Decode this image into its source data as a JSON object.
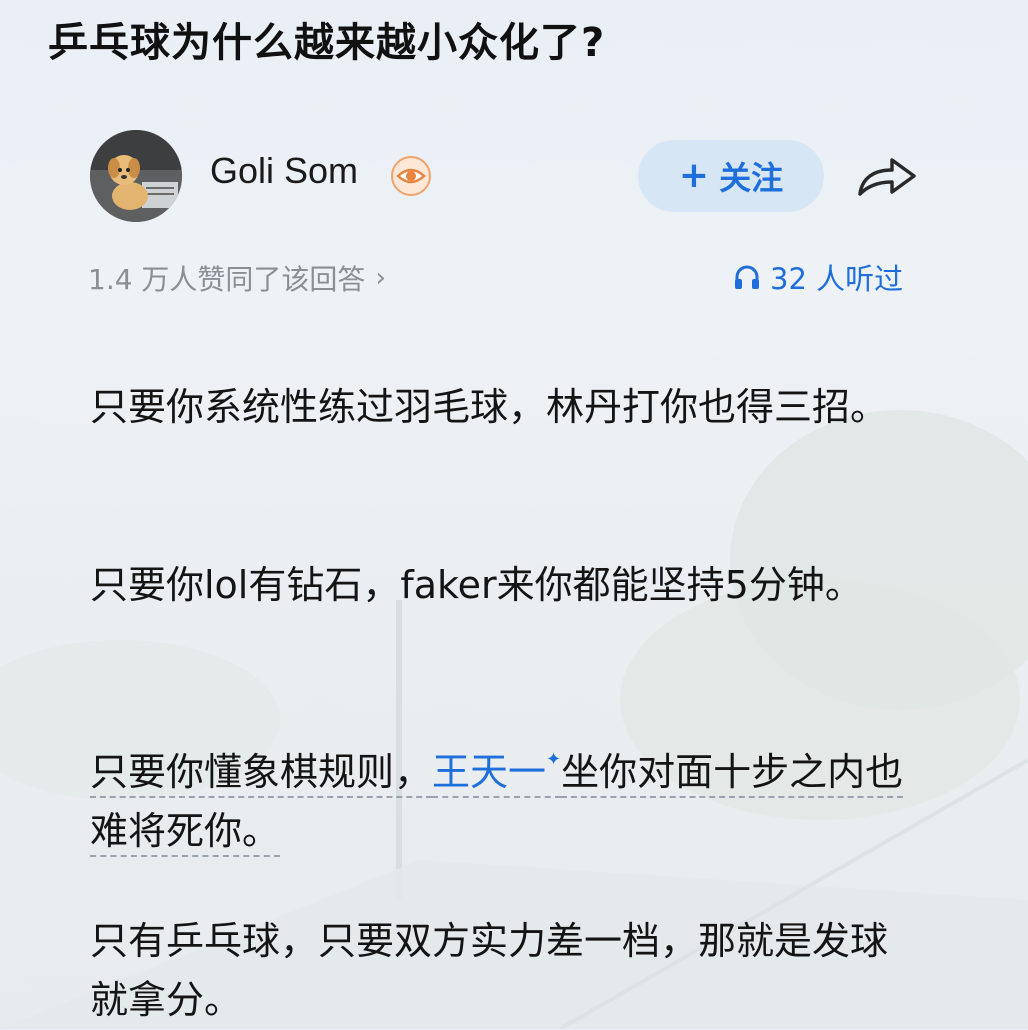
{
  "question": {
    "title": "乒乓球为什么越来越小众化了?"
  },
  "author": {
    "name": "Goli Som",
    "badge_icon": "eye-badge-icon",
    "follow_label": "关注",
    "share_icon": "share-arrow-icon"
  },
  "stats": {
    "likes_text": "1.4 万人赞同了该回答",
    "listens_text": "32 人听过",
    "listens_icon": "headphones-icon"
  },
  "answer": {
    "p1": "只要你系统性练过羽毛球，林丹打你也得三招。",
    "p2": "只要你lol有钻石，faker来你都能坚持5分钟。",
    "p3_before": "只要你懂象棋规则，",
    "p3_link": "王天一",
    "p3_after": "坐你对面十步之内也难将死你。",
    "p4": "只有乒乓球，只要双方实力差一档，那就是发球就拿分。"
  },
  "colors": {
    "accent": "#1e6fdc",
    "follow_bg": "#d7e6f5",
    "muted": "#8a8f95"
  }
}
